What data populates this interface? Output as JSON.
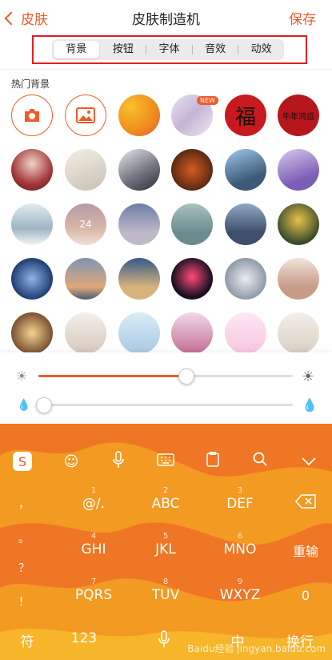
{
  "header": {
    "back_label": "皮肤",
    "title": "皮肤制造机",
    "save_label": "保存"
  },
  "tabs": [
    {
      "label": "背景",
      "active": true
    },
    {
      "label": "按钮",
      "active": false
    },
    {
      "label": "字体",
      "active": false
    },
    {
      "label": "音效",
      "active": false
    },
    {
      "label": "动效",
      "active": false
    }
  ],
  "section": {
    "label": "热门背景"
  },
  "backgrounds": {
    "new_badge": "NEW",
    "fu_text": "福",
    "card_text": "牛年鸿运",
    "thumb_number": "24"
  },
  "sliders": {
    "brightness_value": 0.58,
    "blur_value": 0.02
  },
  "keyboard": {
    "toolbar_icons": [
      "sogou-icon",
      "emoji-icon",
      "mic-icon",
      "keyboard-icon",
      "clipboard-icon",
      "search-icon",
      "collapse-icon"
    ],
    "left_column": [
      "，",
      "。",
      "？",
      "！"
    ],
    "keys": [
      {
        "num": "1",
        "label": "@/."
      },
      {
        "num": "2",
        "label": "ABC"
      },
      {
        "num": "3",
        "label": "DEF"
      },
      {
        "num": "4",
        "label": "GHI"
      },
      {
        "num": "5",
        "label": "JKL"
      },
      {
        "num": "6",
        "label": "MNO"
      },
      {
        "num": "7",
        "label": "PQRS"
      },
      {
        "num": "8",
        "label": "TUV"
      },
      {
        "num": "9",
        "label": "WXYZ"
      }
    ],
    "right_column": [
      "",
      "重输",
      "0"
    ],
    "bottom": {
      "symbol": "符",
      "num_mode": "123",
      "lang": "中",
      "enter": "换行"
    }
  },
  "watermark": "Baidu经验 jingyan.baidu.com",
  "colors": {
    "accent": "#f05a28",
    "keyboard_bg": "#f28a22"
  }
}
